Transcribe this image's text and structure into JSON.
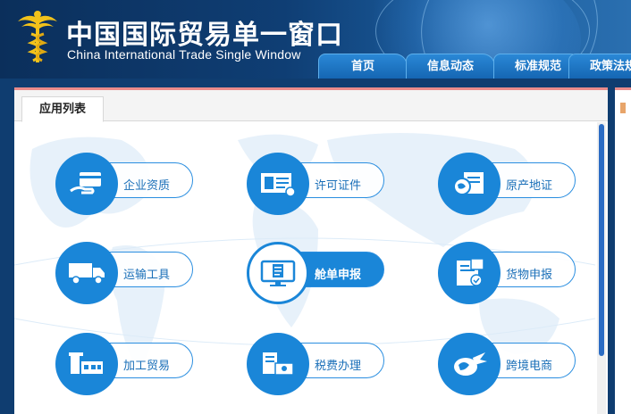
{
  "header": {
    "title_cn": "中国国际贸易单一窗口",
    "title_en": "China International Trade Single  Window"
  },
  "nav": {
    "tabs": [
      {
        "label": "首页"
      },
      {
        "label": "信息动态"
      },
      {
        "label": "标准规范"
      },
      {
        "label": "政策法规"
      }
    ]
  },
  "panel": {
    "tab_label": "应用列表"
  },
  "apps": [
    {
      "label": "企业资质",
      "icon": "company-card-icon"
    },
    {
      "label": "许可证件",
      "icon": "license-document-icon"
    },
    {
      "label": "原产地证",
      "icon": "origin-certificate-icon"
    },
    {
      "label": "运输工具",
      "icon": "truck-icon"
    },
    {
      "label": "舱单申报",
      "icon": "manifest-monitor-icon",
      "active": true
    },
    {
      "label": "货物申报",
      "icon": "cargo-declaration-icon"
    },
    {
      "label": "加工贸易",
      "icon": "factory-icon"
    },
    {
      "label": "税费办理",
      "icon": "tax-payment-icon"
    },
    {
      "label": "跨境电商",
      "icon": "ecommerce-globe-icon"
    }
  ],
  "colors": {
    "accent": "#1a86d8",
    "header_dark": "#0b2f5b",
    "panel_top_border": "#e98b8b"
  }
}
